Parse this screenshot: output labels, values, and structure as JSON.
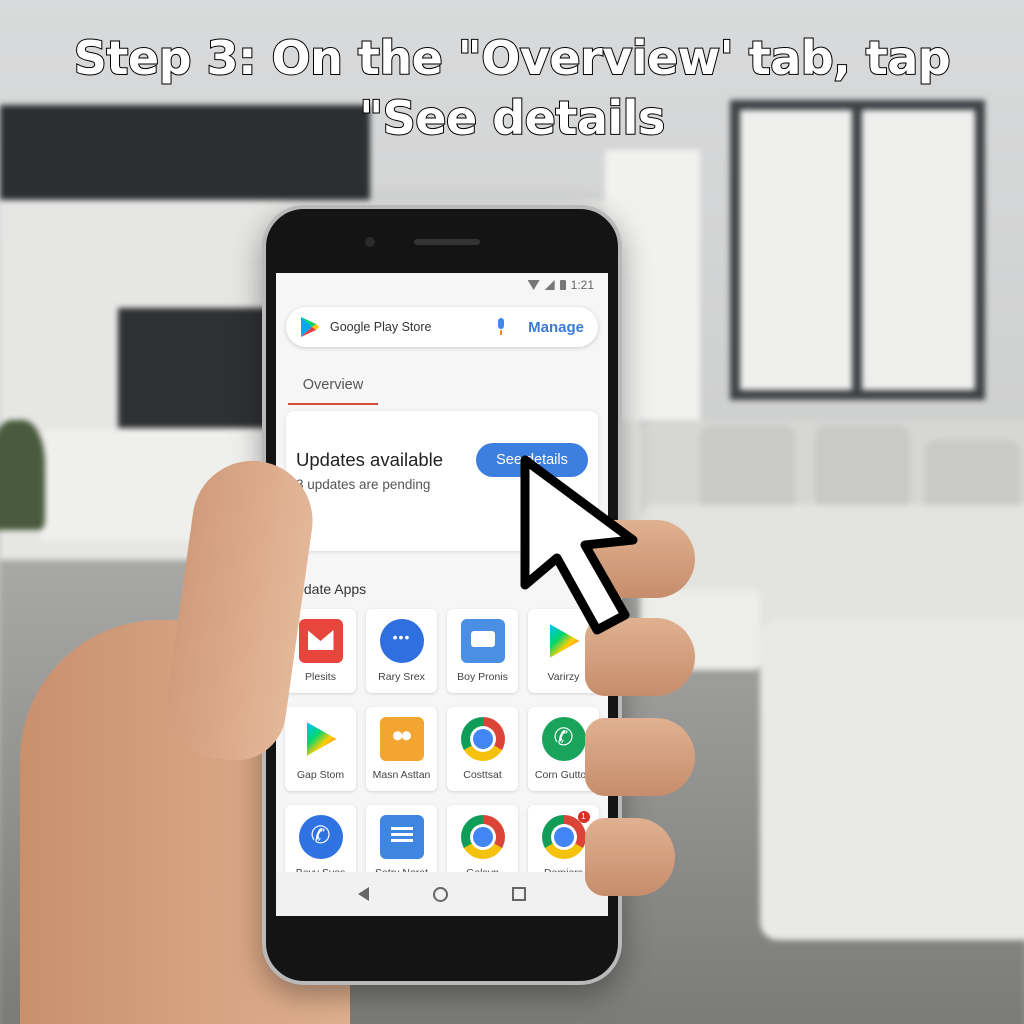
{
  "caption": {
    "line1": "Step 3: On the \"Overview' tab, tap",
    "line2": "\"See details"
  },
  "status_bar": {
    "time": "1:21"
  },
  "search_bar": {
    "icon": "google-play-icon",
    "label": "Google Play Store",
    "mic_icon": "mic-icon",
    "manage_label": "Manage"
  },
  "tabs": [
    {
      "label": "Overview",
      "active": true
    }
  ],
  "update_card": {
    "title": "Updates available",
    "subtitle": "3 updates are pending",
    "button_label": "See details"
  },
  "update_apps": {
    "title": "Update Apps",
    "apps": [
      {
        "label": "Plesits",
        "icon": "gmail-icon"
      },
      {
        "label": "Rary Srex",
        "icon": "chat-bubble-icon"
      },
      {
        "label": "Boy Pronis",
        "icon": "message-icon"
      },
      {
        "label": "Varirzy",
        "icon": "play-triangle-icon"
      },
      {
        "label": "Gap Stom",
        "icon": "play-triangle-icon"
      },
      {
        "label": "Masn Asttan",
        "icon": "contacts-icon"
      },
      {
        "label": "Costtsat",
        "icon": "chrome-icon"
      },
      {
        "label": "Corn Guttop",
        "icon": "phone-icon"
      },
      {
        "label": "Beyy Sves",
        "icon": "phone-icon"
      },
      {
        "label": "Satry Nerat",
        "icon": "note-icon"
      },
      {
        "label": "Galsvp",
        "icon": "chrome-icon"
      },
      {
        "label": "Demiers",
        "icon": "chrome-icon",
        "badge": "1"
      }
    ]
  },
  "nav_bar": {
    "back": "back-icon",
    "home": "home-icon",
    "recents": "recents-icon"
  },
  "colors": {
    "accent_blue": "#3d7fdf",
    "tab_underline": "#d64a3a",
    "caption_text": "#ffffff",
    "caption_outline": "#000000"
  }
}
